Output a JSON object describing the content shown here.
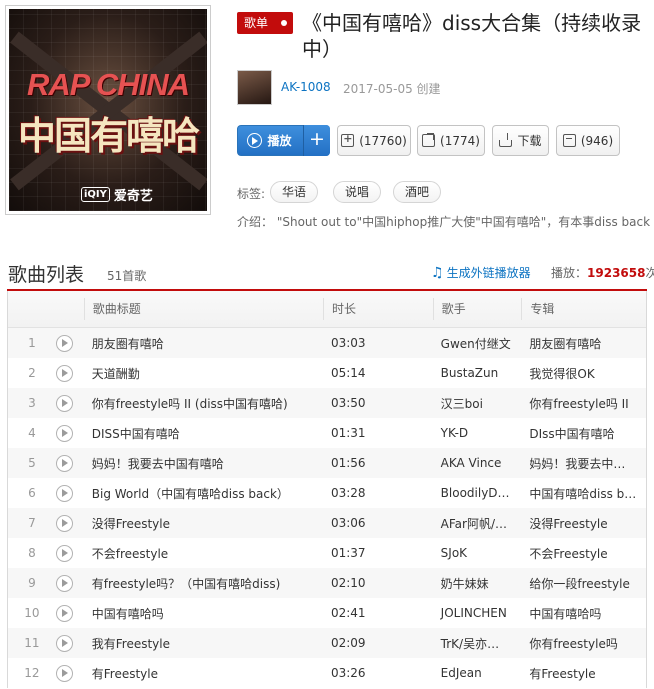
{
  "cover": {
    "title_en": "RAP CHINA",
    "title_cn": "中国有嘻哈",
    "logo_mark": "iQIY",
    "logo_text": "爱奇艺"
  },
  "header": {
    "type_chip": "歌单",
    "title": "《中国有嘻哈》diss大合集（持续收录中）",
    "author": "AK-1008",
    "created": "2017-05-05 创建"
  },
  "actions": {
    "play": "播放",
    "add": "+",
    "favorite": "(17760)",
    "share": "(1774)",
    "download": "下载",
    "comment": "(946)"
  },
  "tags": {
    "label": "标签:",
    "items": [
      "华语",
      "说唱",
      "酒吧"
    ]
  },
  "intro": {
    "label": "介绍：",
    "text": "\"Shout out to\"中国hiphop推广大使\"中国有嘻哈\"，有本事diss back"
  },
  "list": {
    "title": "歌曲列表",
    "count": "51首歌",
    "ext_link": "生成外链播放器",
    "plays_label": "播放：",
    "plays_value": "1923658",
    "plays_unit": "次",
    "columns": [
      "歌曲标题",
      "时长",
      "歌手",
      "专辑"
    ],
    "rows": [
      {
        "idx": "1",
        "name": "朋友圈有嘻哈",
        "time": "03:03",
        "artist": "Gwen付继文",
        "album": "朋友圈有嘻哈"
      },
      {
        "idx": "2",
        "name": "天道酬勤",
        "time": "05:14",
        "artist": "BustaZun",
        "album": "我觉得很OK"
      },
      {
        "idx": "3",
        "name": "你有freestyle吗 II (diss中国有嘻哈)",
        "time": "03:50",
        "artist": "汉三boi",
        "album": "你有freestyle吗 II"
      },
      {
        "idx": "4",
        "name": "DISS中国有嘻哈",
        "time": "01:31",
        "artist": "YK-D",
        "album": "DIss中国有嘻哈"
      },
      {
        "idx": "5",
        "name": "妈妈！我要去中国有嘻哈",
        "time": "01:56",
        "artist": "AKA Vince",
        "album": "妈妈！我要去中…"
      },
      {
        "idx": "6",
        "name": "Big World（中国有嘻哈diss back）",
        "time": "03:28",
        "artist": "BloodilyD…",
        "album": "中国有嘻哈diss b…"
      },
      {
        "idx": "7",
        "name": "没得Freestyle",
        "time": "03:06",
        "artist": "AFar阿帆/…",
        "album": "没得Freestyle"
      },
      {
        "idx": "8",
        "name": "不会freestyle",
        "time": "01:37",
        "artist": "SJoK",
        "album": "不会Freestyle"
      },
      {
        "idx": "9",
        "name": "有freestyle吗？（中国有嘻哈diss)",
        "time": "02:10",
        "artist": "奶牛妹妹",
        "album": "给你一段freestyle"
      },
      {
        "idx": "10",
        "name": "中国有嘻哈吗",
        "time": "02:41",
        "artist": "JOLINCHEN",
        "album": "中国有嘻哈吗"
      },
      {
        "idx": "11",
        "name": "我有Freestyle",
        "time": "02:09",
        "artist": "TrK/吴亦…",
        "album": "你有freestyle吗"
      },
      {
        "idx": "12",
        "name": "有Freestyle",
        "time": "03:26",
        "artist": "EdJean",
        "album": "有Freestyle"
      }
    ]
  }
}
